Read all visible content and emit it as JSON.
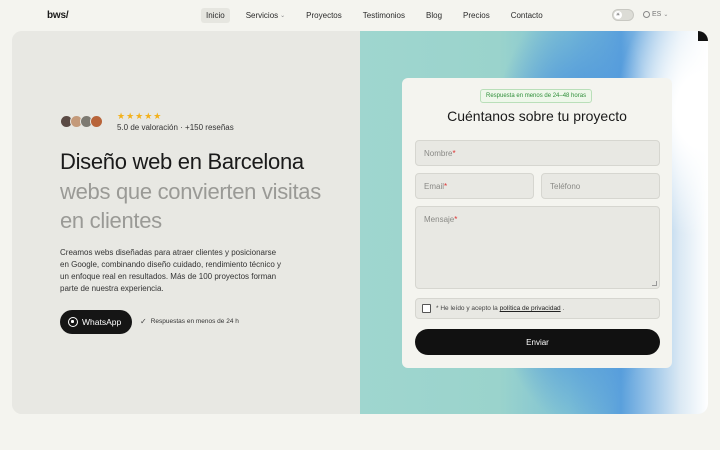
{
  "header": {
    "logo": "bws/",
    "nav": [
      {
        "label": "Inicio",
        "active": true
      },
      {
        "label": "Servicios",
        "has_dropdown": true
      },
      {
        "label": "Proyectos"
      },
      {
        "label": "Testimonios"
      },
      {
        "label": "Blog"
      },
      {
        "label": "Precios"
      },
      {
        "label": "Contacto"
      }
    ],
    "language": "ES"
  },
  "hero": {
    "stars": "★★★★★",
    "rating_text": "5.0 de valoración · +150 reseñas",
    "title": "Diseño web en Barcelona",
    "subtitle": "webs que convierten visitas en clientes",
    "description": "Creamos webs diseñadas para atraer clientes y posicionarse en Google, combinando diseño cuidado, rendimiento técnico y un enfoque real en resultados. Más de 100 proyectos forman parte de nuestra experiencia.",
    "whatsapp_label": "WhatsApp",
    "response_note": "Respuestas en menos de 24 h"
  },
  "form": {
    "badge": "Respuesta en menos de 24–48 horas",
    "title": "Cuéntanos sobre tu proyecto",
    "name_placeholder": "Nombre",
    "email_placeholder": "Email",
    "phone_placeholder": "Teléfono",
    "message_placeholder": "Mensaje",
    "required_mark": "*",
    "privacy_prefix": "* He leído y acepto la",
    "privacy_link": "política de privacidad",
    "privacy_suffix": ".",
    "submit_label": "Enviar"
  },
  "colors": {
    "accent": "#151515",
    "star": "#f3b11b",
    "badge_green": "#2f8f3a",
    "required": "#dd3333"
  }
}
